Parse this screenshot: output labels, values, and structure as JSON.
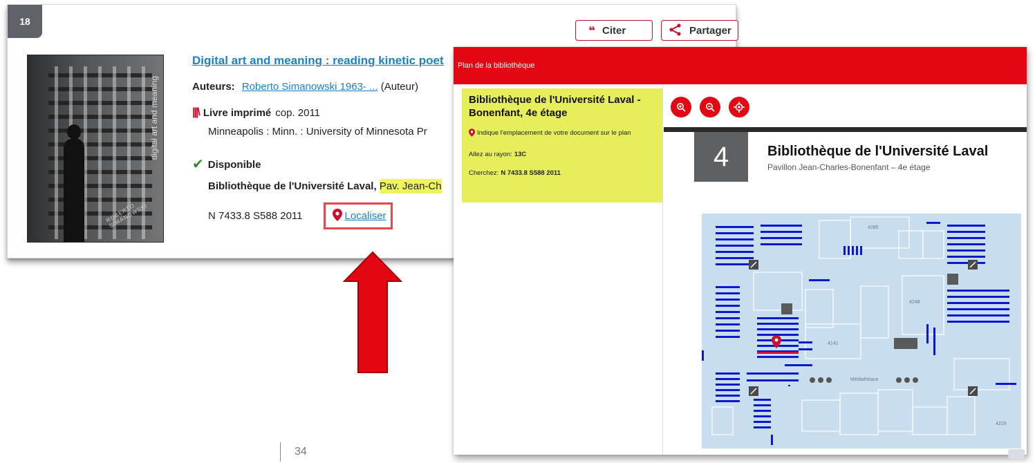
{
  "result": {
    "number": "18",
    "cite_label": "Citer",
    "share_label": "Partager",
    "title_pre": "Digital ",
    "title_hl": "art",
    "title_post": " and meaning : reading kinetic poet",
    "authors_label": "Auteurs:",
    "author_name": "Roberto Simanowski 1963- ...",
    "author_role": "(Auteur)",
    "format_label": "Livre imprimé",
    "format_date": "cop. 2011",
    "publisher": "Minneapolis : Minn. : University of Minnesota Pr",
    "availability": "Disponible",
    "library": "Bibliothèque de l'Université Laval,",
    "location_hl": "Pav. Jean-Ch",
    "call_number": "N 7433.8 S588 2011",
    "localiser_label": "Localiser",
    "cover_spine": "digital art and meaning",
    "cover_author": "ROBERTO SIMANOWSKI"
  },
  "map": {
    "header_title": "Plan de la bibliothèque",
    "info_title": "Bibliothèque de l'Université Laval - Bonenfant, 4e étage",
    "info_indicate": "Indique l'emplacement de votre document sur le plan",
    "info_go_label": "Allez au rayon:",
    "info_go_value": "13C",
    "info_search_label": "Cherchez:",
    "info_search_value": "N 7433.8 S588 2011",
    "floor_number": "4",
    "plan_title": "Bibliothèque de l'Université Laval",
    "plan_subtitle": "Pavillon Jean-Charles-Bonenfant – 4e étage",
    "room_labels": [
      "4285",
      "4248",
      "4141",
      "Médiathèque",
      "4229"
    ]
  },
  "page": {
    "page_number": "34"
  },
  "icons": {
    "cite": "quote-icon",
    "share": "share-icon",
    "format": "books-icon",
    "available": "check-icon",
    "pin": "map-pin-icon",
    "zoom_in": "zoom-in-icon",
    "zoom_out": "zoom-out-icon",
    "locate": "locate-icon"
  },
  "colors": {
    "accent_red": "#e30613",
    "link_blue": "#1a83c6",
    "highlight_yellow": "#e6ee5c",
    "shelf_blue": "#0a1acb",
    "floor_bg": "#c8ddee"
  }
}
